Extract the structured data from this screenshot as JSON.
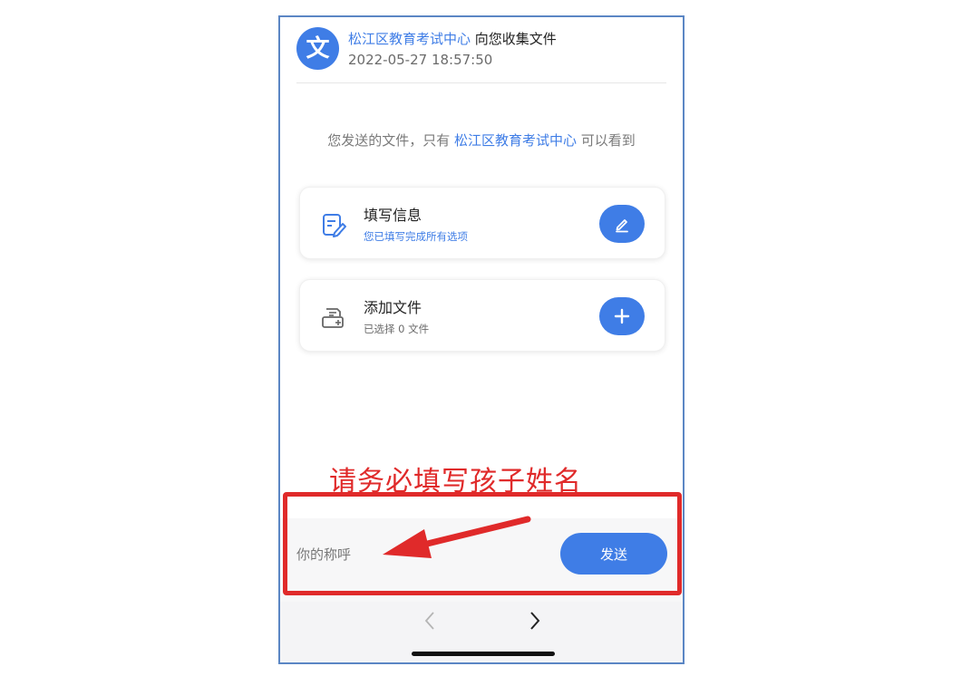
{
  "header": {
    "logo_glyph": "文",
    "sender": "松江区教育考试中心",
    "action_text": " 向您收集文件",
    "timestamp": "2022-05-27 18:57:50"
  },
  "notice": {
    "prefix": "您发送的文件，只有 ",
    "highlight": "松江区教育考试中心",
    "suffix": " 可以看到"
  },
  "cards": [
    {
      "title": "填写信息",
      "subtitle": "您已填写完成所有选项",
      "subtitle_color": "#3f7de6",
      "icon": "form-edit-icon",
      "button_icon": "pencil-icon"
    },
    {
      "title": "添加文件",
      "subtitle": "已选择 0 文件",
      "subtitle_color": "#6b6b6b",
      "icon": "add-file-icon",
      "button_icon": "plus-icon"
    }
  ],
  "bottom_bar": {
    "nickname_placeholder": "你的称呼",
    "nickname_value": "",
    "send_label": "发送"
  },
  "browser_nav": {
    "back_icon": "chevron-left-icon",
    "forward_icon": "chevron-right-icon"
  },
  "annotation": {
    "text": "请务必填写孩子姓名",
    "color": "#e02a2a"
  },
  "colors": {
    "accent": "#3f7de6",
    "annotation_red": "#e02a2a"
  }
}
